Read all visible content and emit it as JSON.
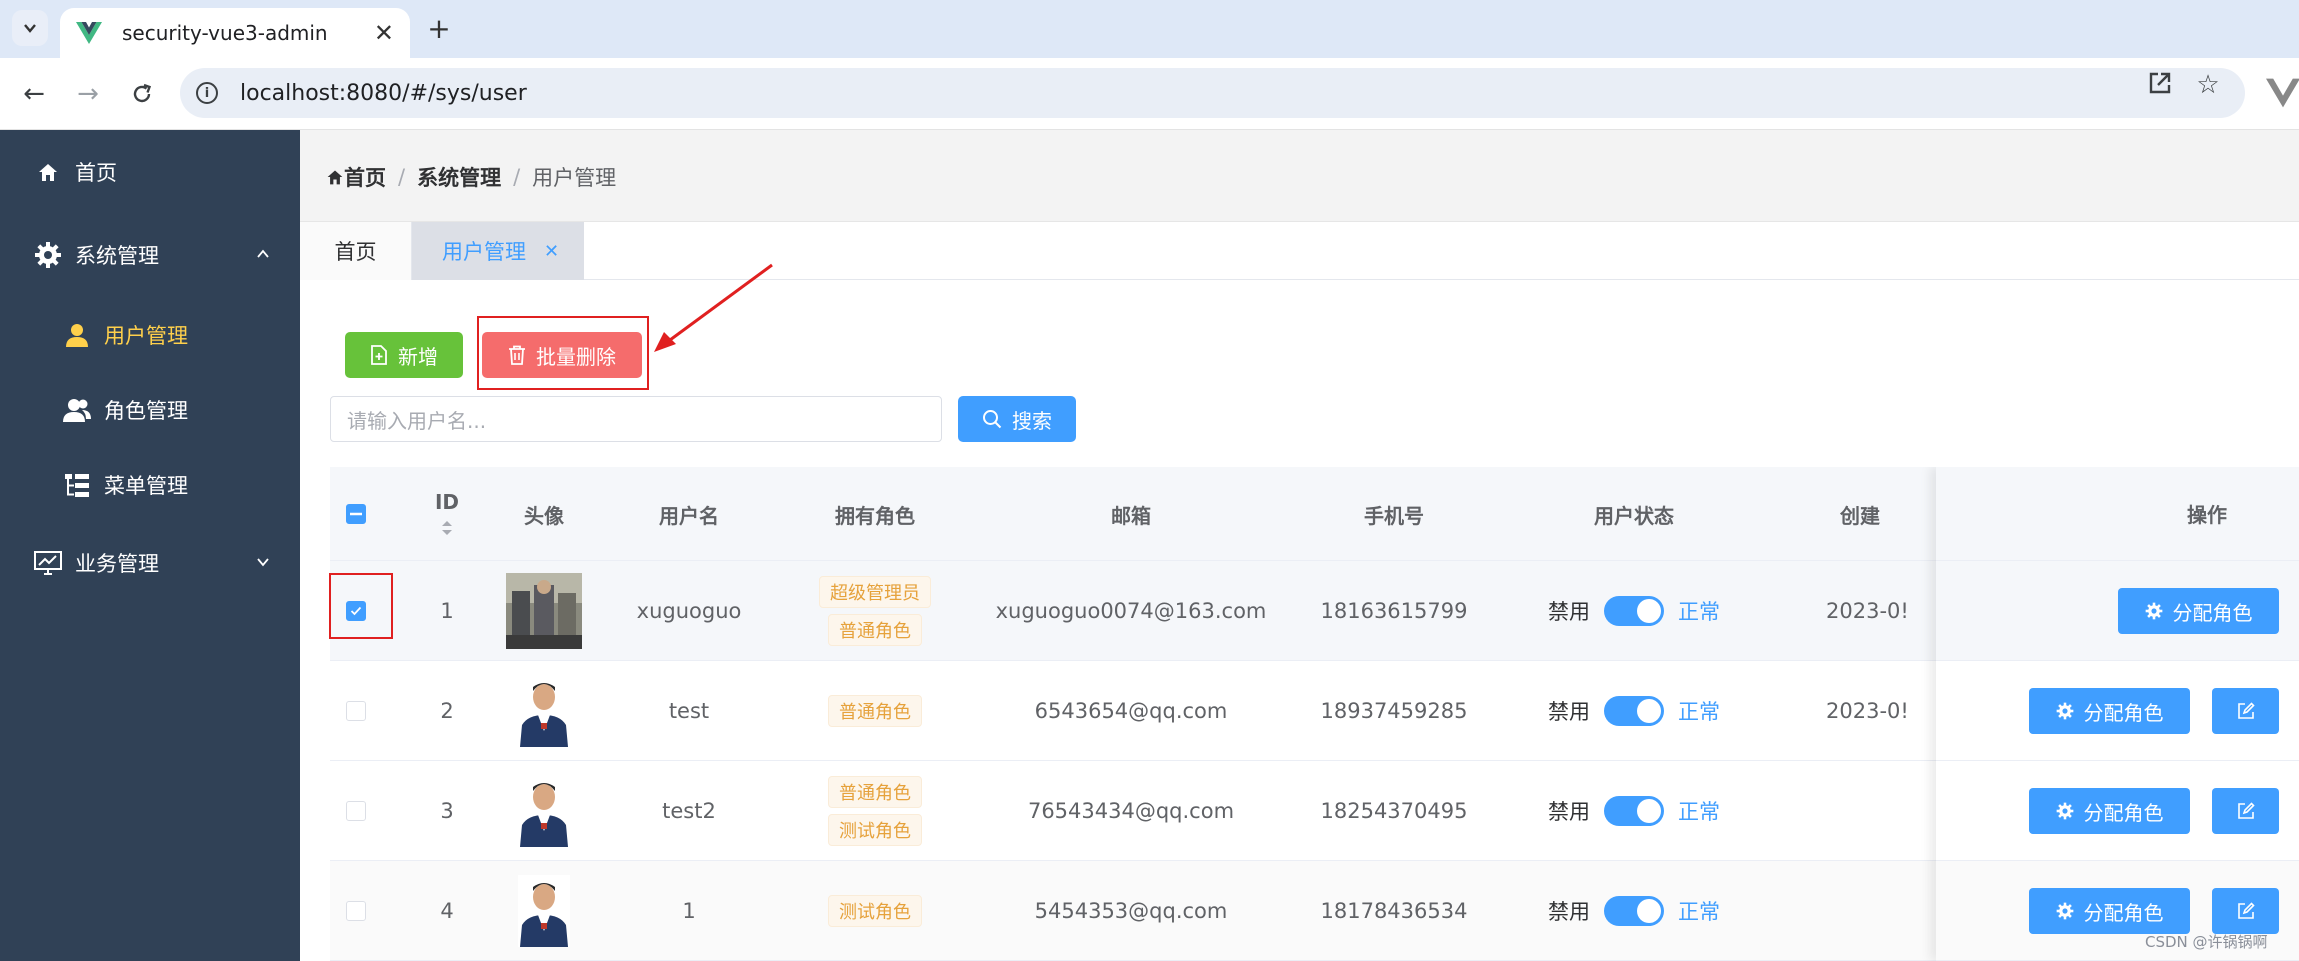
{
  "browser": {
    "tab_title": "security-vue3-admin",
    "url": "localhost:8080/#/sys/user"
  },
  "sidebar": {
    "items": [
      {
        "label": "首页"
      },
      {
        "label": "系统管理"
      },
      {
        "label": "用户管理"
      },
      {
        "label": "角色管理"
      },
      {
        "label": "菜单管理"
      },
      {
        "label": "业务管理"
      }
    ],
    "active_color": "#ffd04b",
    "bg_color": "#304156"
  },
  "breadcrumb": {
    "home": "首页",
    "system": "系统管理",
    "current": "用户管理",
    "sep": "/"
  },
  "page_tabs": {
    "home": "首页",
    "user": "用户管理"
  },
  "toolbar": {
    "add_label": "新增",
    "batch_delete_label": "批量删除",
    "search_placeholder": "请输入用户名...",
    "search_label": "搜索"
  },
  "table": {
    "headers": {
      "id": "ID",
      "avatar": "头像",
      "username": "用户名",
      "roles": "拥有角色",
      "email": "邮箱",
      "phone": "手机号",
      "status": "用户状态",
      "created": "创建",
      "actions": "操作"
    },
    "status_off": "禁用",
    "status_on": "正常",
    "assign_role_label": "分配角色",
    "rows": [
      {
        "id": "1",
        "username": "xuguoguo",
        "roles": [
          "超级管理员",
          "普通角色"
        ],
        "email": "xuguoguo0074@163.com",
        "phone": "18163615799",
        "created": "2023-0!",
        "selected": true
      },
      {
        "id": "2",
        "username": "test",
        "roles": [
          "普通角色"
        ],
        "email": "6543654@qq.com",
        "phone": "18937459285",
        "created": "2023-0!",
        "selected": false
      },
      {
        "id": "3",
        "username": "test2",
        "roles": [
          "普通角色",
          "测试角色"
        ],
        "email": "76543434@qq.com",
        "phone": "18254370495",
        "created": "",
        "selected": false
      },
      {
        "id": "4",
        "username": "1",
        "roles": [
          "测试角色"
        ],
        "email": "5454353@qq.com",
        "phone": "18178436534",
        "created": "",
        "selected": false
      }
    ]
  },
  "watermark": "CSDN @许锅锅啊",
  "colors": {
    "primary": "#409eff",
    "success": "#67c23a",
    "danger": "#f56c6c",
    "warning_tag": "#e6a23c",
    "annotation": "#e02020"
  }
}
